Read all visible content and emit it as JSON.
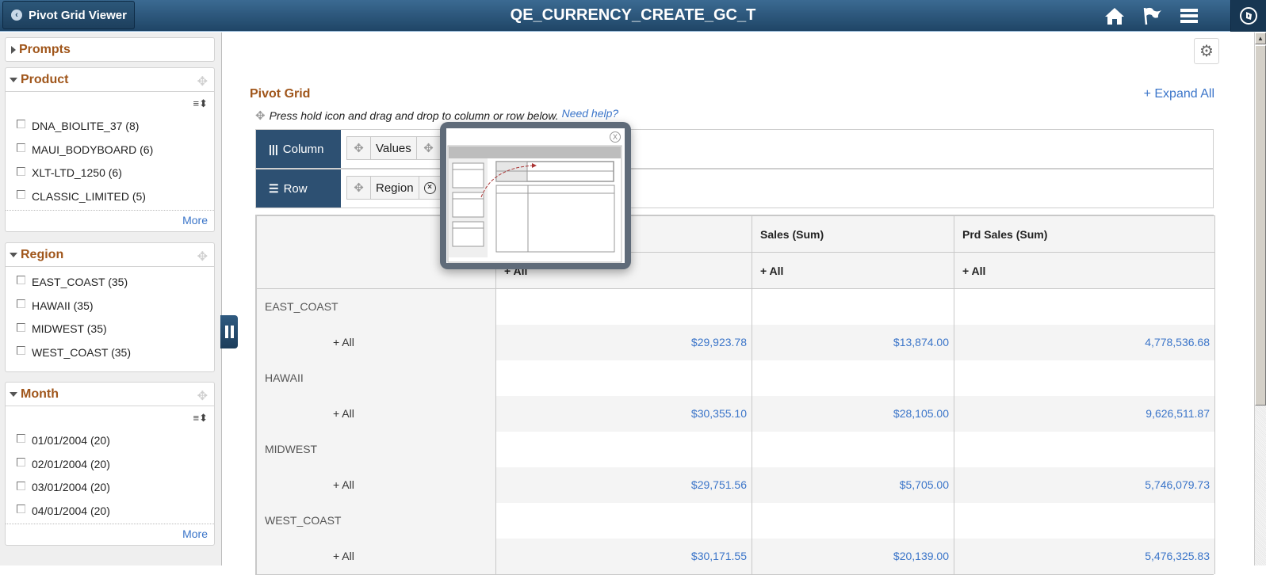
{
  "header": {
    "back_label": "Pivot Grid Viewer",
    "title": "QE_CURRENCY_CREATE_GC_T",
    "icons": [
      "home-icon",
      "flag-icon",
      "menu-icon",
      "navbar-compass-icon"
    ]
  },
  "left_panel": {
    "prompts": {
      "title": "Prompts"
    },
    "facets": [
      {
        "title": "Product",
        "items": [
          "DNA_BIOLITE_37 (8)",
          "MAUI_BODYBOARD (6)",
          "XLT-LTD_1250 (6)",
          "CLASSIC_LIMITED (5)"
        ],
        "more": "More"
      },
      {
        "title": "Region",
        "items": [
          "EAST_COAST (35)",
          "HAWAII (35)",
          "MIDWEST (35)",
          "WEST_COAST (35)"
        ]
      },
      {
        "title": "Month",
        "items": [
          "01/01/2004 (20)",
          "02/01/2004 (20)",
          "03/01/2004 (20)",
          "04/01/2004 (20)"
        ],
        "more": "More"
      }
    ]
  },
  "main": {
    "title": "Pivot Grid",
    "expand_all": "+ Expand All",
    "instruction": "Press hold icon and drag and drop to column or row below.",
    "need_help": "Need help?",
    "column_label": "Column",
    "row_label": "Row",
    "column_chips": [
      "Values"
    ],
    "row_chips": [
      "Region"
    ]
  },
  "grid": {
    "headers": [
      "",
      "Sales (Sum)",
      "Prd Sales (Sum)"
    ],
    "subheaders": [
      "+ All",
      "+ All",
      "+ All"
    ],
    "all_label": "+ All",
    "rows": [
      {
        "region": "EAST_COAST",
        "values": [
          "$29,923.78",
          "$13,874.00",
          "4,778,536.68"
        ]
      },
      {
        "region": "HAWAII",
        "values": [
          "$30,355.10",
          "$28,105.00",
          "9,626,511.87"
        ]
      },
      {
        "region": "MIDWEST",
        "values": [
          "$29,751.56",
          "$5,705.00",
          "5,746,079.73"
        ]
      },
      {
        "region": "WEST_COAST",
        "values": [
          "$30,171.55",
          "$20,139.00",
          "5,476,325.83"
        ]
      }
    ]
  },
  "popup": {
    "close_label": "X"
  }
}
